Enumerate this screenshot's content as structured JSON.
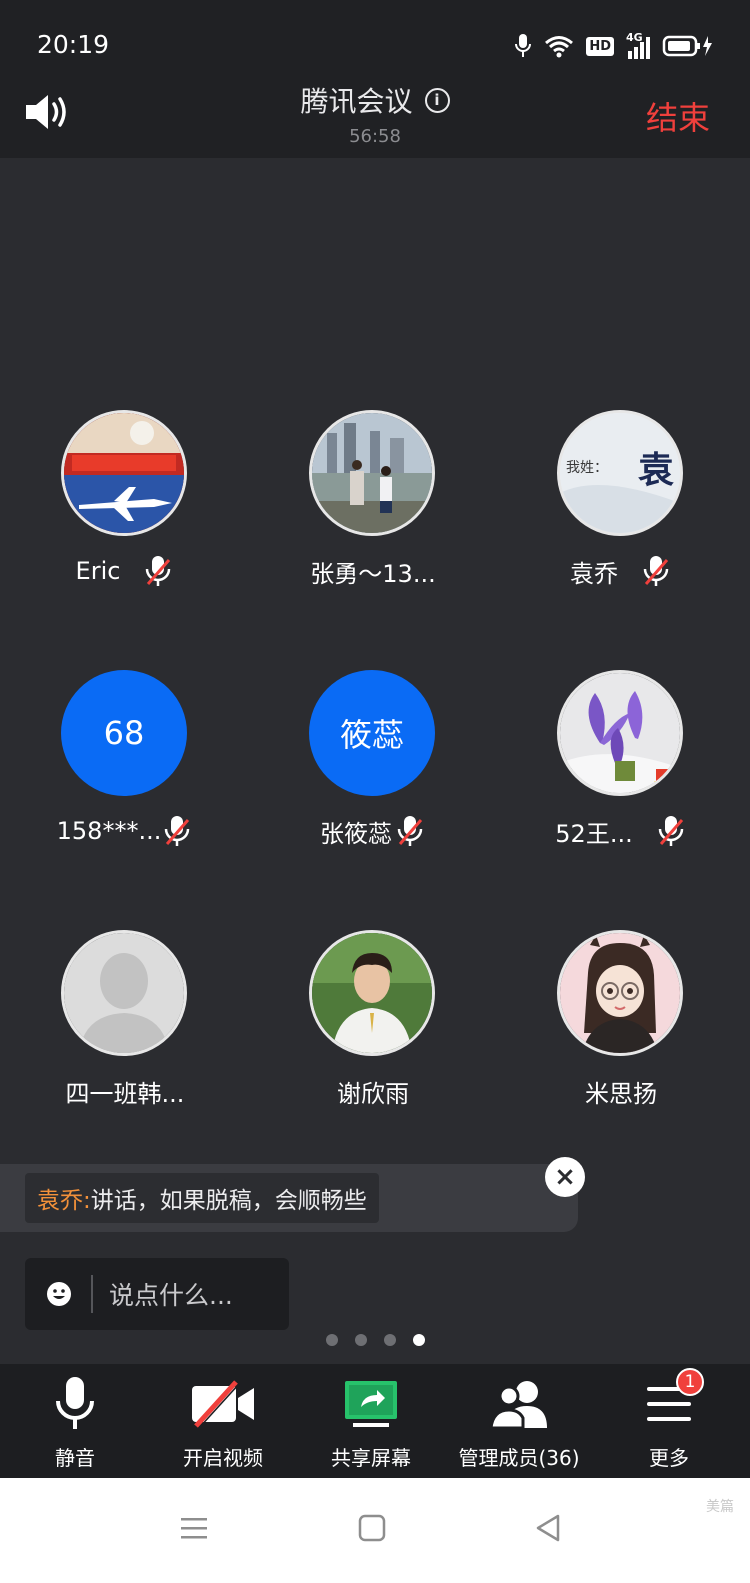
{
  "status_bar": {
    "time": "20:19",
    "hd_label": "HD",
    "network": "4G"
  },
  "header": {
    "title": "腾讯会议",
    "timer": "56:58",
    "end_label": "结束"
  },
  "participants": [
    {
      "name": "Eric",
      "muted": true,
      "avatar_text": ""
    },
    {
      "name": "张勇～13...",
      "muted": false,
      "avatar_text": ""
    },
    {
      "name": "袁乔",
      "muted": true,
      "avatar_text": "袁",
      "avatar_subtext": "我姓："
    },
    {
      "name": "158***...",
      "muted": true,
      "avatar_text": "68"
    },
    {
      "name": "张筱蕊",
      "muted": true,
      "avatar_text": "筱蕊"
    },
    {
      "name": "52王...",
      "muted": true,
      "avatar_text": ""
    },
    {
      "name": "四一班韩...",
      "muted": false,
      "avatar_text": ""
    },
    {
      "name": "谢欣雨",
      "muted": false,
      "avatar_text": ""
    },
    {
      "name": "米思扬",
      "muted": false,
      "avatar_text": ""
    }
  ],
  "chat": {
    "sender": "袁乔:",
    "message": " 讲话，如果脱稿，会顺畅些",
    "close_icon": "×"
  },
  "input": {
    "placeholder": "说点什么..."
  },
  "pager": {
    "count": 4,
    "active": 4
  },
  "toolbar": {
    "items": [
      {
        "label": "静音",
        "icon": "microphone-icon"
      },
      {
        "label": "开启视频",
        "icon": "video-off-icon"
      },
      {
        "label": "共享屏幕",
        "icon": "share-screen-icon"
      },
      {
        "label": "管理成员(36)",
        "icon": "members-icon"
      },
      {
        "label": "更多",
        "icon": "menu-icon",
        "badge": "1"
      }
    ]
  },
  "watermark": "美篇",
  "colors": {
    "accent": "#0a6bf5",
    "end": "#f0403c",
    "sender": "#f3913a",
    "share": "#27c26b"
  }
}
